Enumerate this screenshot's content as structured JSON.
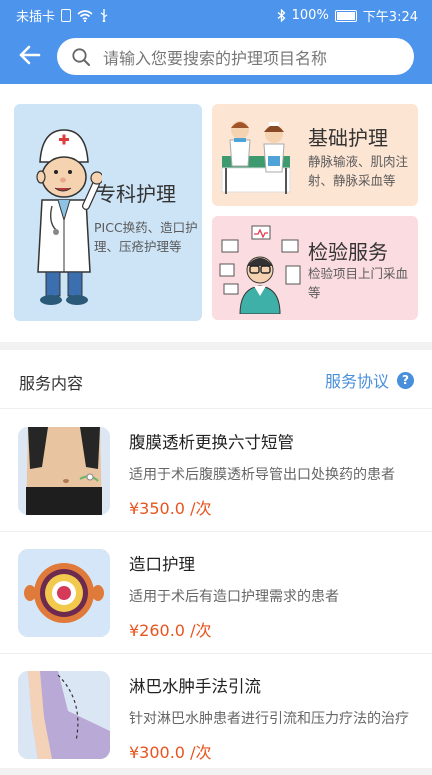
{
  "status_bar": {
    "carrier": "未插卡",
    "battery": "100%",
    "time": "下午3:24"
  },
  "search": {
    "placeholder": "请输入您要搜索的护理项目名称"
  },
  "categories": [
    {
      "title": "专科护理",
      "desc": "PICC换药、造口护理、压疮护理等"
    },
    {
      "title": "基础护理",
      "desc": "静脉输液、肌肉注射、静脉采血等"
    },
    {
      "title": "检验服务",
      "desc": "检验项目上门采血等"
    }
  ],
  "services": {
    "title": "服务内容",
    "agreement": "服务协议",
    "help_symbol": "?",
    "items": [
      {
        "name": "腹膜透析更换六寸短管",
        "desc": "适用于术后腹膜透析导管出口处换药的患者",
        "price": "¥350.0 /次"
      },
      {
        "name": "造口护理",
        "desc": "适用于术后有造口护理需求的患者",
        "price": "¥260.0 /次"
      },
      {
        "name": "淋巴水肿手法引流",
        "desc": "针对淋巴水肿患者进行引流和压力疗法的治疗",
        "price": "¥300.0 /次"
      }
    ]
  },
  "colors": {
    "header": "#4d95ec",
    "link": "#4a8fdc",
    "price": "#e8541e"
  }
}
